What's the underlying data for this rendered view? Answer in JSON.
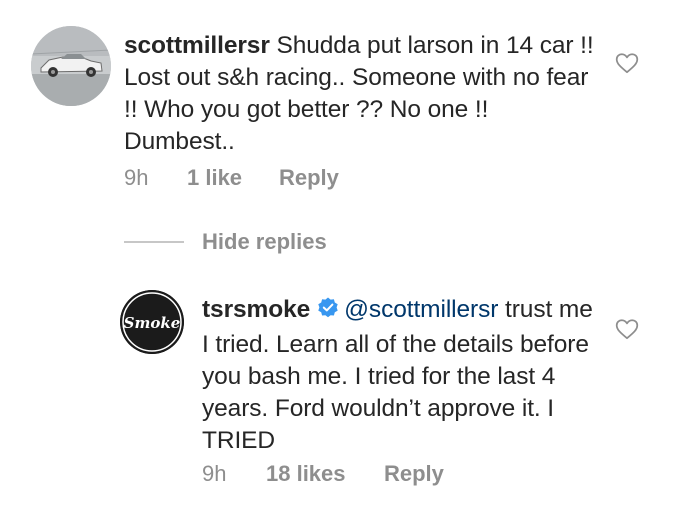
{
  "comments": [
    {
      "username": "scottmillersr",
      "text": "Shudda put larson in 14 car !! Lost out s&h racing.. Someone with no fear !! Who you got better ?? No one !! Dumbest..",
      "time": "9h",
      "likes": "1 like",
      "reply_label": "Reply",
      "avatar_icon": "car-photo-avatar",
      "like_icon": "heart-outline-icon"
    },
    {
      "username": "tsrsmoke",
      "verified_icon": "verified-badge-icon",
      "verified_color": "#3897f0",
      "mention": "@scottmillersr",
      "text": "trust me I tried. Learn all of the details before you bash me. I tried for the last 4 years. Ford wouldn’t approve it. I TRIED",
      "time": "9h",
      "likes": "18 likes",
      "reply_label": "Reply",
      "avatar_icon": "smoke-logo-avatar",
      "avatar_logo_text": "Smoke",
      "like_icon": "heart-outline-icon"
    }
  ],
  "replies_toggle": {
    "label": "Hide replies"
  },
  "colors": {
    "text": "#262626",
    "secondary": "#8e8e8e",
    "mention": "#00376b",
    "verified": "#3897f0"
  }
}
